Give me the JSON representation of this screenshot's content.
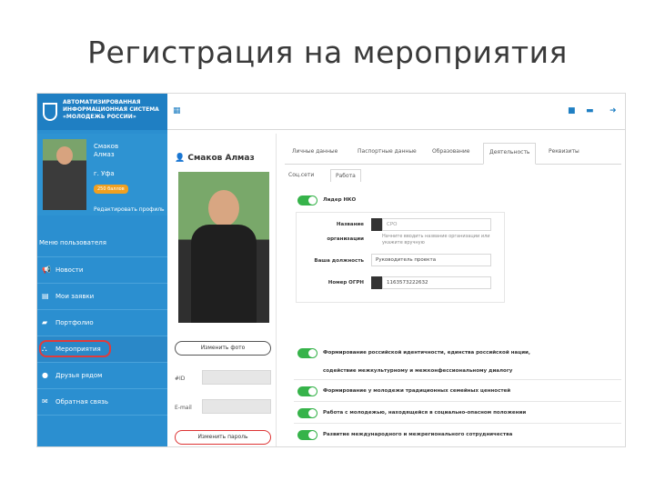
{
  "slide": {
    "title": "Регистрация на мероприятия"
  },
  "brand": {
    "line1": "АВТОМАТИЗИРОВАННАЯ",
    "line2": "ИНФОРМАЦИОННАЯ СИСТЕМА",
    "line3": "«МОЛОДЕЖЬ РОССИИ»"
  },
  "profile": {
    "surname": "Смаков",
    "name": "Алмаз",
    "city": "г. Уфа",
    "badge": "250 баллов",
    "edit_link": "Редактировать профиль",
    "full_name": "Смаков Алмаз"
  },
  "menu": {
    "header": "Меню пользователя",
    "items": [
      {
        "label": "Новости",
        "icon": "megaphone-icon"
      },
      {
        "label": "Мои заявки",
        "icon": "clipboard-icon"
      },
      {
        "label": "Портфолио",
        "icon": "folder-icon"
      },
      {
        "label": "Мероприятия",
        "icon": "sitemap-icon"
      },
      {
        "label": "Друзья рядом",
        "icon": "location-pin-icon"
      },
      {
        "label": "Обратная связь",
        "icon": "feedback-icon"
      }
    ]
  },
  "left_panel": {
    "change_photo": "Изменить фото",
    "id_label": "#ID",
    "email_label": "E-mail",
    "change_password": "Изменить пароль"
  },
  "tabs": {
    "items": [
      "Личные данные",
      "Паспортные данные",
      "Образование",
      "Деятельность",
      "Реквизиты"
    ],
    "active": "Деятельность"
  },
  "subtabs": {
    "items": [
      "Соц.сети",
      "Работа"
    ],
    "active": "Работа"
  },
  "nko": {
    "toggle_label": "Лидер НКО",
    "name_label": "Название",
    "name_placeholder": "СРО",
    "org_label": "организации",
    "org_note": "Начните вводить название организации или укажите вручную",
    "position_label": "Ваша должность",
    "position_value": "Руководитель проекта",
    "ogrn_label": "Номер ОГРН",
    "ogrn_value": "1163573222632"
  },
  "interests": [
    "Формирование российской идентичности, единства российской нации,",
    "содействие межкультурному и межконфессиональному диалогу",
    "Формирование у молодежи традиционных семейных ценностей",
    "Работа с молодежью, находящейся в социально-опасном положении",
    "Развитие международного и межрегионального сотрудничества"
  ],
  "colors": {
    "sidebar": "#2b8fd0",
    "toggle": "#36b34a",
    "highlight": "#e13b3b"
  }
}
